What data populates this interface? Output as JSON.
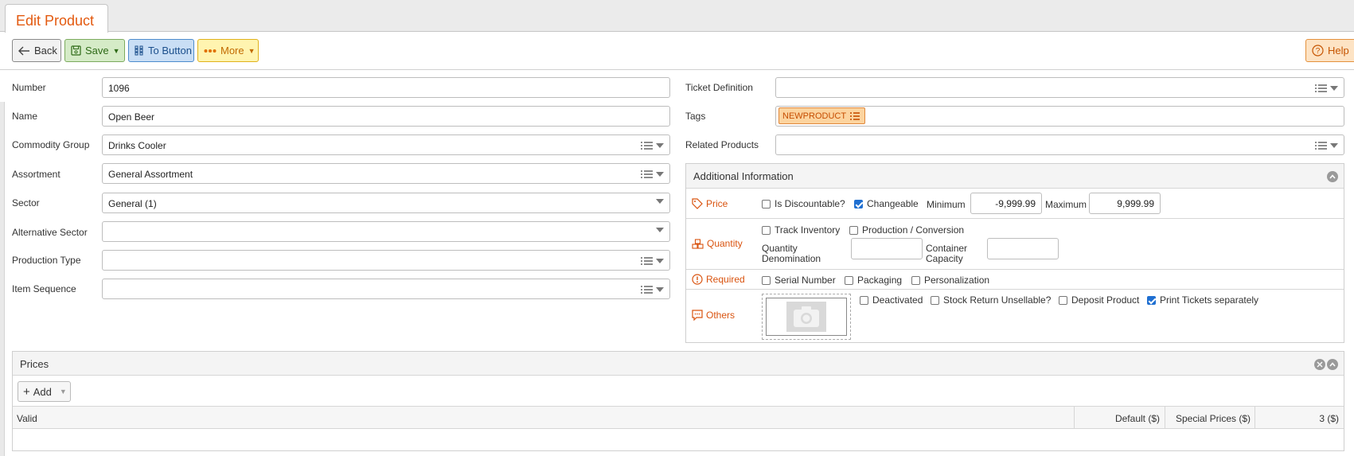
{
  "tab": {
    "title": "Edit Product"
  },
  "toolbar": {
    "back": "Back",
    "save": "Save",
    "to_button": "To Button",
    "more": "More",
    "help": "Help"
  },
  "form": {
    "number": {
      "label": "Number",
      "value": "1096"
    },
    "name": {
      "label": "Name",
      "value": "Open Beer"
    },
    "commodity_group": {
      "label": "Commodity Group",
      "value": "Drinks Cooler"
    },
    "assortment": {
      "label": "Assortment",
      "value": "General Assortment"
    },
    "sector": {
      "label": "Sector",
      "value": "General (1)"
    },
    "alternative_sector": {
      "label": "Alternative Sector",
      "value": ""
    },
    "production_type": {
      "label": "Production Type",
      "value": ""
    },
    "item_sequence": {
      "label": "Item Sequence",
      "value": ""
    },
    "ticket_definition": {
      "label": "Ticket Definition",
      "value": ""
    },
    "tags": {
      "label": "Tags",
      "chips": [
        "NEWPRODUCT"
      ]
    },
    "related_products": {
      "label": "Related Products",
      "value": ""
    }
  },
  "additional": {
    "title": "Additional Information",
    "price": {
      "label": "Price",
      "is_discountable": "Is Discountable?",
      "is_discountable_checked": false,
      "changeable": "Changeable",
      "changeable_checked": true,
      "minimum_label": "Minimum",
      "minimum": "-9,999.99",
      "maximum_label": "Maximum",
      "maximum": "9,999.99"
    },
    "quantity": {
      "label": "Quantity",
      "track_inventory": "Track Inventory",
      "production_conversion": "Production / Conversion",
      "quantity_denomination_1": "Quantity",
      "quantity_denomination_2": "Denomination",
      "container_capacity_1": "Container",
      "container_capacity_2": "Capacity"
    },
    "required": {
      "label": "Required",
      "serial_number": "Serial Number",
      "packaging": "Packaging",
      "personalization": "Personalization"
    },
    "others": {
      "label": "Others",
      "deactivated": "Deactivated",
      "stock_return_unsellable": "Stock Return Unsellable?",
      "deposit_product": "Deposit Product",
      "print_tickets_separately": "Print Tickets separately",
      "print_tickets_checked": true
    }
  },
  "prices": {
    "title": "Prices",
    "add": "Add",
    "columns": [
      "Valid",
      "Default ($)",
      "Special Prices ($)",
      "3 ($)"
    ]
  },
  "colors": {
    "accent": "#e35a10",
    "save": "#d5ebc7",
    "to_button": "#c9def5",
    "more": "#fff4b0",
    "help": "#fde3c4"
  }
}
